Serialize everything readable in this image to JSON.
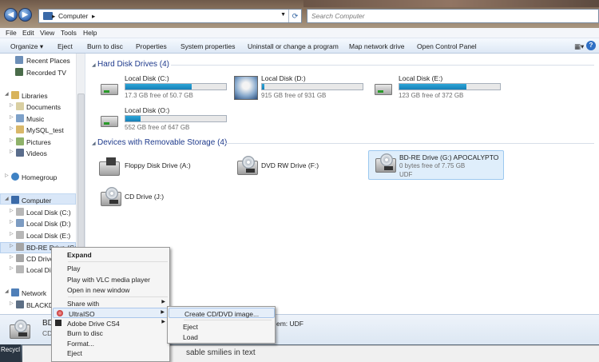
{
  "address": {
    "path": "Computer",
    "search_placeholder": "Search Computer"
  },
  "menubar": [
    "File",
    "Edit",
    "View",
    "Tools",
    "Help"
  ],
  "toolbar": {
    "organize": "Organize",
    "buttons": [
      "Eject",
      "Burn to disc",
      "Properties",
      "System properties",
      "Uninstall or change a program",
      "Map network drive",
      "Open Control Panel"
    ]
  },
  "nav": {
    "recent_places": "Recent Places",
    "recorded_tv": "Recorded TV",
    "libraries": "Libraries",
    "documents": "Documents",
    "music": "Music",
    "mysql_test": "MySQL_test",
    "pictures": "Pictures",
    "videos": "Videos",
    "homegroup": "Homegroup",
    "computer": "Computer",
    "local_c": "Local Disk (C:)",
    "local_d": "Local Disk (D:)",
    "local_e": "Local Disk (E:)",
    "bdre": "BD-RE Drive (G:)",
    "cd_drive": "CD Drive",
    "local_disk": "Local Disk",
    "network": "Network",
    "blackdog": "BLACKDO"
  },
  "groups": {
    "hdd_header": "Hard Disk Drives (4)",
    "removable_header": "Devices with Removable Storage (4)"
  },
  "drives": {
    "c": {
      "name": "Local Disk (C:)",
      "free": "17.3 GB free of 50.7 GB",
      "used_fraction": 0.66
    },
    "d": {
      "name": "Local Disk (D:)",
      "free": "915 GB free of 931 GB",
      "used_fraction": 0.02
    },
    "e": {
      "name": "Local Disk (E:)",
      "free": "123 GB free of 372 GB",
      "used_fraction": 0.67
    },
    "o": {
      "name": "Local Disk (O:)",
      "free": "552 GB free of 647 GB",
      "used_fraction": 0.15
    },
    "floppy": {
      "name": "Floppy Disk Drive (A:)"
    },
    "dvd": {
      "name": "DVD RW Drive (F:)"
    },
    "bdre": {
      "name": "BD-RE Drive (G:) APOCALYPTO",
      "free": "0 bytes free of 7.75 GB",
      "fs": "UDF"
    },
    "cd": {
      "name": "CD Drive (J:)"
    }
  },
  "details": {
    "name": "BD",
    "sub": "CD",
    "fs": "em: UDF"
  },
  "context_menu": {
    "expand": "Expand",
    "play": "Play",
    "play_vlc": "Play with VLC media player",
    "open_new": "Open in new window",
    "share_with": "Share with",
    "ultraiso": "UltraISO",
    "adobe_drive": "Adobe Drive CS4",
    "burn": "Burn to disc",
    "format": "Format...",
    "eject": "Eject"
  },
  "submenu": {
    "create_image": "Create CD/DVD image...",
    "eject": "Eject",
    "load": "Load"
  },
  "taskbar": {
    "recycle": "Recycl",
    "bg_text": "sable smilies in text"
  }
}
